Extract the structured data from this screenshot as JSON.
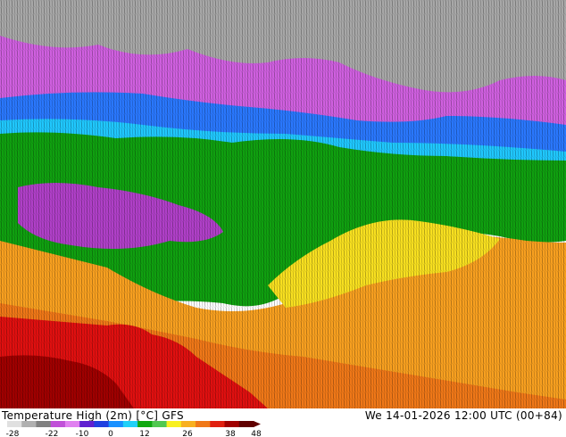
{
  "legend": {
    "title_parts": [
      "Temperature High (2m) [°C]",
      "GFS"
    ],
    "datetime": "We 14-01-2026 12:00 UTC (00+84)",
    "ticks": [
      "-28",
      "-22",
      "-10",
      "0",
      "12",
      "26",
      "38",
      "48"
    ]
  },
  "colors": {
    "grey": "#a8a8a8",
    "magenta": "#d060e0",
    "deep_magenta": "#b040c8",
    "purple": "#9040d0",
    "dark_blue": "#3040e0",
    "blue": "#2a78ff",
    "cyan": "#20c8ff",
    "green": "#10a010",
    "light_green": "#40c040",
    "yellow": "#f8e020",
    "orange": "#f8a020",
    "dark_orange": "#f07818",
    "red": "#e01010",
    "dark_red": "#a00000"
  },
  "scale_colors": [
    "#e0e0e0",
    "#b0b0b0",
    "#808080",
    "#c050d8",
    "#e080f0",
    "#6020d0",
    "#2040e0",
    "#1890ff",
    "#20d0f8",
    "#10a810",
    "#50c850",
    "#f8f020",
    "#f8b020",
    "#f07818",
    "#e02010",
    "#a00000",
    "#600000"
  ]
}
